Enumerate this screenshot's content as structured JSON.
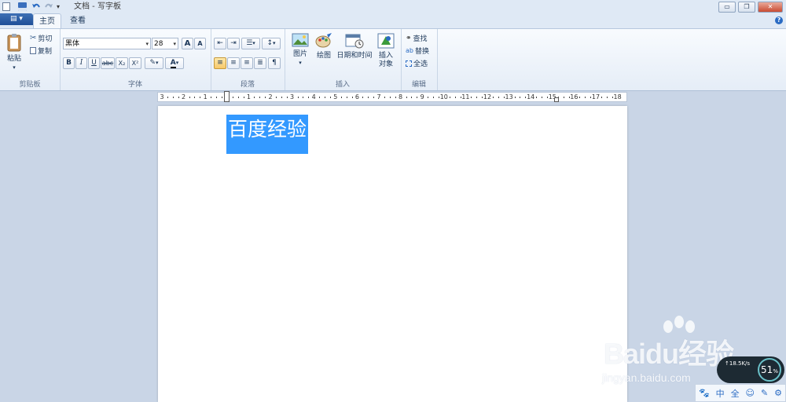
{
  "window": {
    "title": "文档 - 写字板",
    "controls": {
      "minimize": "▭",
      "restore": "❐",
      "close": "✕"
    }
  },
  "quick_access": {
    "icons": [
      "save-icon",
      "undo-icon",
      "redo-icon",
      "customize-icon"
    ]
  },
  "app_menu": {
    "label": "▤ ▾"
  },
  "tabs": [
    {
      "label": "主页",
      "active": true
    },
    {
      "label": "查看",
      "active": false
    }
  ],
  "help": {
    "label": "?"
  },
  "ribbon": {
    "clipboard": {
      "label": "剪贴板",
      "paste": "粘贴",
      "cut": "剪切",
      "copy": "复制"
    },
    "font": {
      "label": "字体",
      "font_name": "黑体",
      "font_size": "28",
      "grow": "A",
      "shrink": "A",
      "bold": "B",
      "italic": "I",
      "underline": "U",
      "strike": "abc",
      "subscript": "X₂",
      "superscript": "X²",
      "highlight": "✎",
      "color": "A"
    },
    "paragraph": {
      "label": "段落"
    },
    "insert": {
      "label": "插入",
      "picture": "图片",
      "paint": "绘图",
      "datetime": "日期和时间",
      "object_line1": "插入",
      "object_line2": "对象"
    },
    "editing": {
      "label": "编辑",
      "find": "查找",
      "replace": "替换",
      "select_all": "全选"
    }
  },
  "ruler": {
    "labels": [
      "3",
      "2",
      "1",
      "1",
      "1",
      "2",
      "3",
      "4",
      "5",
      "6",
      "7",
      "8",
      "9",
      "10",
      "11",
      "12",
      "13",
      "14",
      "15",
      "16",
      "17",
      "18"
    ]
  },
  "document": {
    "selected_text": "百度经验"
  },
  "watermark": {
    "logo": "Baidu经验",
    "url": "jingyan.baidu.com"
  },
  "net_speed": {
    "rate": "↑18.5K/s",
    "percent": "51",
    "percent_sign": "%"
  },
  "ime_bar": {
    "items": [
      "🐾",
      "中",
      "全",
      "☺",
      "✎",
      "⚙"
    ]
  },
  "colors": {
    "selection": "#3399ff",
    "ribbon_bg": "#e5edf7",
    "workspace": "#c9d5e6"
  }
}
